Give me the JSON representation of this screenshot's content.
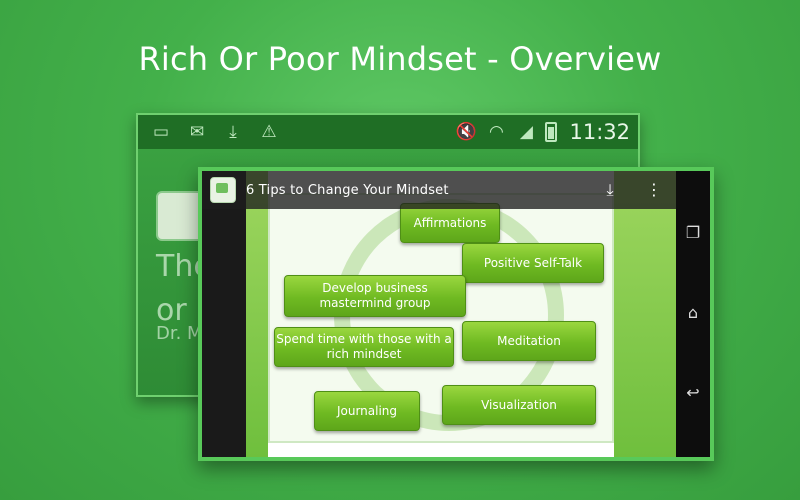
{
  "headline": "Rich Or Poor Mindset - Overview",
  "status_bar": {
    "time": "11:32",
    "icons": [
      "image-icon",
      "mail-icon",
      "download-icon",
      "warning-icon",
      "mute-icon",
      "wifi-icon",
      "signal-icon",
      "battery-icon"
    ]
  },
  "back_screen": {
    "title_line1": "The",
    "title_line2": "or P",
    "subtitle": "Dr. M"
  },
  "front_screen": {
    "topbar_title": "6  Tips to Change Your Mindset",
    "diagram_items": [
      "Affirmations",
      "Positive Self-Talk",
      "Develop business mastermind group",
      "Meditation",
      "Spend time with those with a rich mindset",
      "Visualization",
      "Journaling"
    ]
  },
  "nav": {
    "icons": [
      "recent-apps-icon",
      "home-icon",
      "back-icon"
    ]
  },
  "colors": {
    "background": "#43b04a",
    "accent": "#58c95a",
    "box_green": "#6fba22"
  }
}
